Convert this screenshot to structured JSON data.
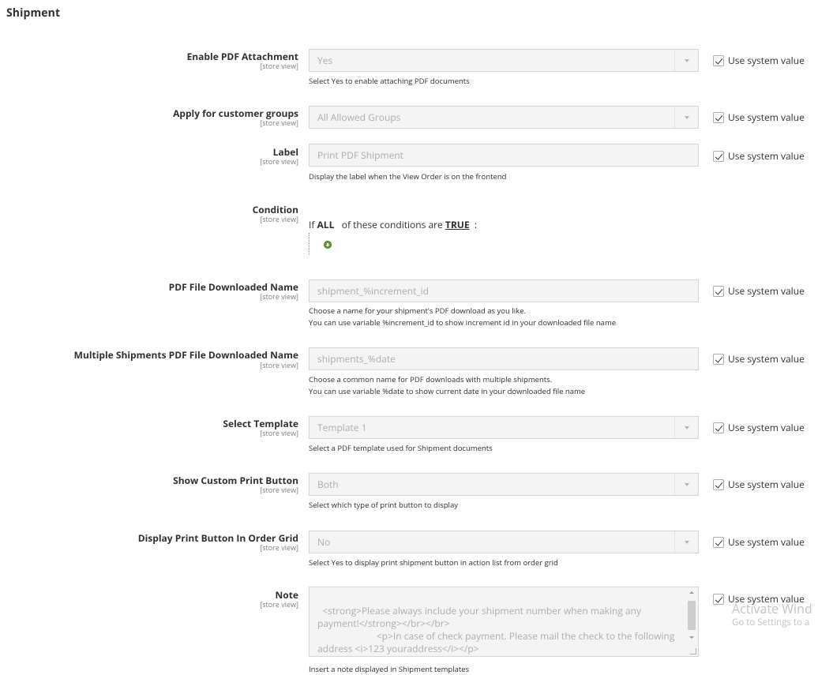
{
  "section": {
    "title": "Shipment"
  },
  "scope_label": "[store view]",
  "use_system_value_label": "Use system value",
  "fields": {
    "enable_pdf": {
      "label": "Enable PDF Attachment",
      "value": "Yes",
      "note": "Select Yes to enable attaching PDF documents",
      "use_system": true
    },
    "customer_groups": {
      "label": "Apply for customer groups",
      "value": "All Allowed Groups",
      "use_system": true
    },
    "label": {
      "label": "Label",
      "placeholder": "Print PDF Shipment",
      "note": "Display the label when the View Order is on the frontend",
      "use_system": true
    },
    "condition": {
      "label": "Condition",
      "prefix": "If",
      "aggregator": "ALL",
      "middle": "of these conditions are",
      "value": "TRUE",
      "suffix": ":"
    },
    "pdf_file_name": {
      "label": "PDF File Downloaded Name",
      "placeholder": "shipment_%increment_id",
      "note_line1": "Choose a name for your shipment's PDF download as you like.",
      "note_line2": "You can use variable %increment_id to show increment id in your downloaded file name",
      "use_system": true
    },
    "multi_pdf_file_name": {
      "label": "Multiple Shipments PDF File Downloaded Name",
      "placeholder": "shipments_%date",
      "note_line1": "Choose a common name for PDF downloads with multiple shipments.",
      "note_line2": "You can use variable %date to show current date in your downloaded file name",
      "use_system": true
    },
    "template": {
      "label": "Select Template",
      "value": "Template 1",
      "note": "Select a PDF template used for Shipment documents",
      "use_system": true
    },
    "custom_print_button": {
      "label": "Show Custom Print Button",
      "value": "Both",
      "note": "Select which type of print button to display",
      "use_system": true
    },
    "print_in_grid": {
      "label": "Display Print Button In Order Grid",
      "value": "No",
      "note": "Select Yes to display print shipment button in action list from order grid",
      "use_system": true
    },
    "note": {
      "label": "Note",
      "value": "<strong>Please always include your shipment number when making any payment!</strong></br></br>\n                        <p>In case of check payment. Please mail the check to the following address <i>123 youraddress</i></p>\n                        <p>For question/concerning regarding this shipment,please contact  <i>youremail@example.com</i></p>",
      "note": "Insert a note displayed in Shipment templates",
      "use_system": true
    }
  },
  "watermark": {
    "title": "Activate Wind",
    "subtitle": "Go to Settings to a"
  }
}
